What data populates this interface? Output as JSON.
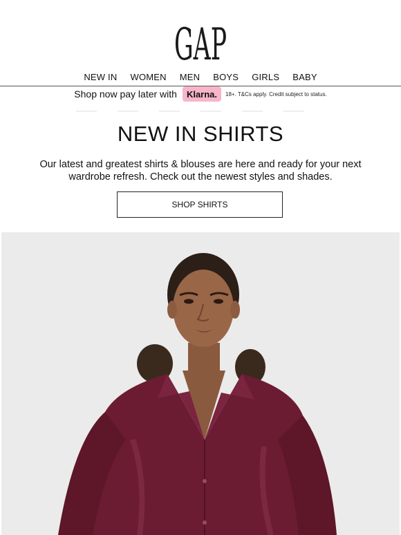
{
  "brand": {
    "logo_text": "GAP"
  },
  "nav": {
    "items": [
      {
        "label": "NEW IN"
      },
      {
        "label": "WOMEN"
      },
      {
        "label": "MEN"
      },
      {
        "label": "BOYS"
      },
      {
        "label": "GIRLS"
      },
      {
        "label": "BABY"
      }
    ]
  },
  "klarna": {
    "text": "Shop now pay later with",
    "badge": "Klarna.",
    "note": "18+. T&Cs apply. Credit subject to status.",
    "badge_color": "#f7b5c9"
  },
  "hero_section": {
    "headline": "NEW IN SHIRTS",
    "body": "Our latest and greatest shirts & blouses are here and ready for your next wardrobe refresh. Check out the newest styles and shades.",
    "cta_label": "SHOP SHIRTS"
  },
  "hero_image": {
    "subject": "model-in-burgundy-velvet-shirt",
    "shirt_color": "#6b1c33",
    "background_color": "#ebebeb"
  }
}
